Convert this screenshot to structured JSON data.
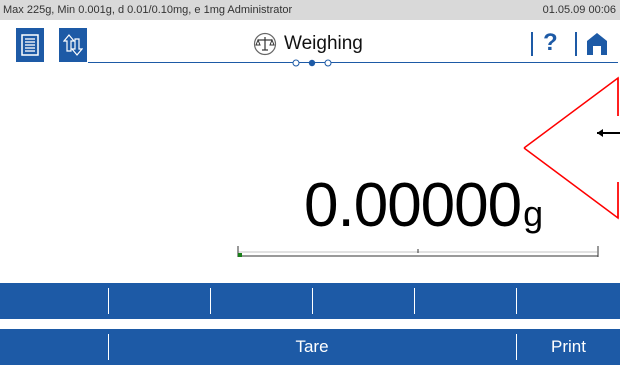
{
  "status": {
    "info": "Max 225g, Min 0.001g, d 0.01/0.10mg, e 1mg  Administrator",
    "datetime": "01.05.09 00:06"
  },
  "header": {
    "title": "Weighing",
    "help_label": "?"
  },
  "display": {
    "value": "0.00000",
    "unit": "g"
  },
  "softkeys": {
    "tare": "Tare",
    "print": "Print"
  },
  "colors": {
    "accent": "#1d5aa6",
    "annotation_arrow": "#ff0000"
  },
  "icons": [
    "menu-list-icon",
    "transfer-icon",
    "balance-scale-icon",
    "help-icon",
    "home-icon"
  ]
}
